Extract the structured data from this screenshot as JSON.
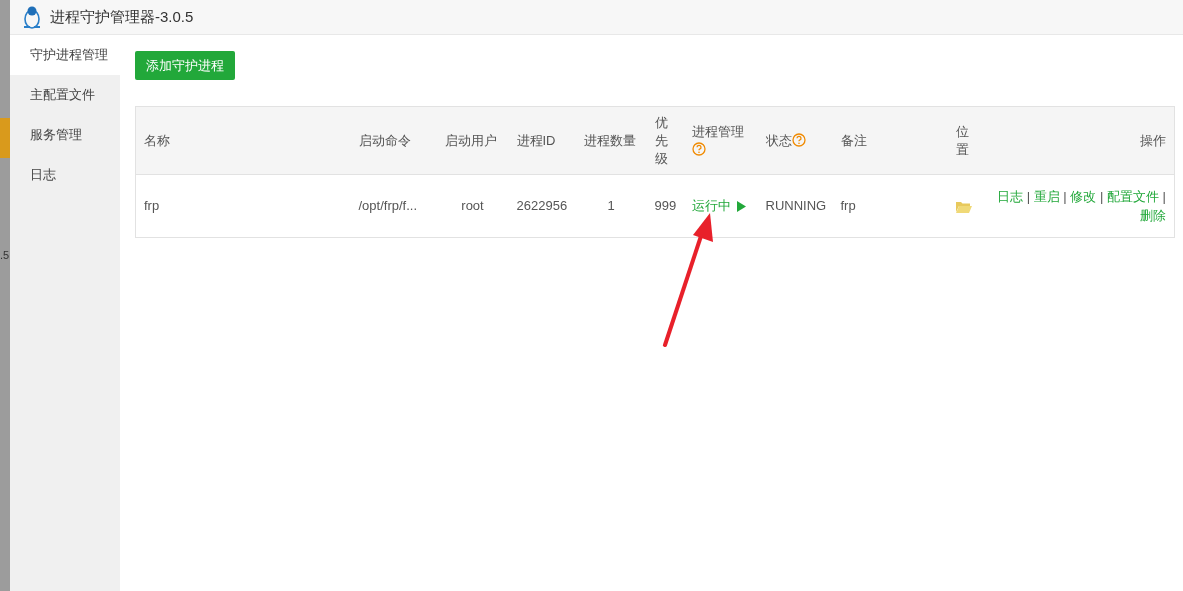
{
  "background_page": {
    "fragment": ".5"
  },
  "window": {
    "title": "进程守护管理器-3.0.5"
  },
  "sidebar": {
    "items": [
      {
        "label": "守护进程管理",
        "selected": true
      },
      {
        "label": "主配置文件",
        "selected": false
      },
      {
        "label": "服务管理",
        "selected": false
      },
      {
        "label": "日志",
        "selected": false
      }
    ]
  },
  "add_button": "添加守护进程",
  "table": {
    "columns": [
      {
        "label": "名称",
        "help": false
      },
      {
        "label": "启动命令",
        "help": false
      },
      {
        "label": "启动用户",
        "help": false
      },
      {
        "label": "进程ID",
        "help": false
      },
      {
        "label": "进程数量",
        "help": false
      },
      {
        "label": "优先级",
        "help": false
      },
      {
        "label": "进程管理",
        "help": true
      },
      {
        "label": "状态",
        "help": true
      },
      {
        "label": "备注",
        "help": false
      },
      {
        "label": "位置",
        "help": false
      },
      {
        "label": "操作",
        "help": false
      }
    ],
    "rows": [
      {
        "cells": [
          {
            "kind": "text",
            "text": "frp"
          },
          {
            "kind": "text",
            "text": "/opt/frp/f..."
          },
          {
            "kind": "text",
            "text": "root"
          },
          {
            "kind": "text",
            "text": "2622956"
          },
          {
            "kind": "text",
            "text": "1"
          },
          {
            "kind": "text",
            "text": "999"
          },
          {
            "kind": "run",
            "text": "运行中"
          },
          {
            "kind": "text",
            "text": "RUNNING"
          },
          {
            "kind": "text",
            "text": "frp"
          },
          {
            "kind": "folder"
          },
          {
            "kind": "actions",
            "separator": "|",
            "links": [
              "日志",
              "重启",
              "修改",
              "配置文件",
              "删除"
            ]
          }
        ]
      }
    ]
  }
}
